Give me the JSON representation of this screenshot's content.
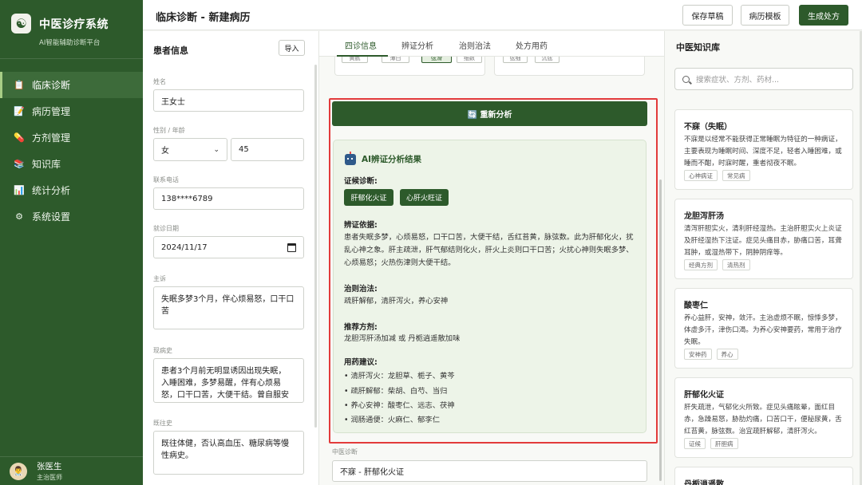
{
  "brand": {
    "title": "中医诊疗系统",
    "subtitle": "AI智能辅助诊断平台",
    "logo": "☯"
  },
  "nav": [
    {
      "label": "临床诊断",
      "icon": "clipboard-icon",
      "glyph": "📋",
      "active": true
    },
    {
      "label": "病历管理",
      "icon": "document-icon",
      "glyph": "📝",
      "active": false
    },
    {
      "label": "方剂管理",
      "icon": "pill-icon",
      "glyph": "💊",
      "active": false
    },
    {
      "label": "知识库",
      "icon": "books-icon",
      "glyph": "📚",
      "active": false
    },
    {
      "label": "统计分析",
      "icon": "chart-icon",
      "glyph": "📊",
      "active": false
    },
    {
      "label": "系统设置",
      "icon": "gear-icon",
      "glyph": "⚙",
      "active": false
    }
  ],
  "user": {
    "name": "张医生",
    "role": "主治医师",
    "avatar": "👨‍⚕️"
  },
  "header": {
    "title": "临床诊断 - 新建病历",
    "save_draft": "保存草稿",
    "template": "病历模板",
    "generate": "生成处方"
  },
  "patient": {
    "title": "患者信息",
    "import_label": "导入",
    "name_label": "姓名",
    "name": "王女士",
    "sex_age_label": "性别 / 年龄",
    "sex": "女",
    "age": "45",
    "phone_label": "联系电话",
    "phone": "138****6789",
    "date_label": "就诊日期",
    "date": "2024/11/17",
    "complaint_label": "主诉",
    "complaint": "失眠多梦3个月，伴心烦易怒，口干口苦",
    "history_label": "现病史",
    "history": "患者3个月前无明显诱因出现失眠，入睡困难，多梦易醒，伴有心烦易怒，口干口苦，大便干结。曾自服安神补脑液，效果不佳。",
    "past_label": "既往史",
    "past": "既往体健，否认高血压、糖尿病等慢性病史。"
  },
  "tabs": [
    {
      "label": "四诊信息",
      "active": true
    },
    {
      "label": "辨证分析",
      "active": false
    },
    {
      "label": "治则治法",
      "active": false
    },
    {
      "label": "处方用药",
      "active": false
    }
  ],
  "stub_chips": [
    "黄腻",
    "薄白",
    "弦滑",
    "细数",
    "弦细",
    "沉弦"
  ],
  "analysis": {
    "reanalyze": "🔄 重新分析",
    "result_title": "AI辨证分析结果",
    "dx_label": "证候诊断:",
    "dx_tags": [
      "肝郁化火证",
      "心肝火旺证"
    ],
    "basis_label": "辨证依据:",
    "basis": "患者失眠多梦，心烦易怒，口干口苦，大便干结，舌红苔黄，脉弦数。此为肝郁化火，扰乱心神之象。肝主疏泄，肝气郁结则化火，肝火上炎则口干口苦；火扰心神则失眠多梦、心烦易怒；火热伤津则大便干结。",
    "method_label": "治则治法:",
    "method": "疏肝解郁，清肝泻火，养心安神",
    "formula_label": "推荐方剂:",
    "formula": "龙胆泻肝汤加减 或 丹栀逍遥散加味",
    "herbs_label": "用药建议:",
    "herbs": [
      "• 清肝泻火：龙胆草、栀子、黄芩",
      "• 疏肝解郁：柴胡、白芍、当归",
      "• 养心安神：酸枣仁、远志、茯神",
      "• 润肠通便：火麻仁、郁李仁"
    ]
  },
  "tcm_dx": {
    "label": "中医诊断",
    "value": "不寐 - 肝郁化火证"
  },
  "kb": {
    "title": "中医知识库",
    "search_placeholder": "搜索症状、方剂、药材...",
    "cards": [
      {
        "name": "不寐（失眠）",
        "desc": "不寐是以经常不能获得正常睡眠为特征的一种病证，主要表现为睡眠时间、深度不足，轻者入睡困难，或睡而不酣，时寐时醒，重者彻夜不眠。",
        "tags": [
          "心神病证",
          "常见病"
        ]
      },
      {
        "name": "龙胆泻肝汤",
        "desc": "清泻肝胆实火，清利肝经湿热。主治肝胆实火上炎证及肝经湿热下注证。症见头痛目赤，胁痛口苦，耳聋耳肿，或湿热带下，阴肿阴痒等。",
        "tags": [
          "经典方剂",
          "清热剂"
        ]
      },
      {
        "name": "酸枣仁",
        "desc": "养心益肝，安神，敛汗。主治虚烦不眠，惊悸多梦，体虚多汗，津伤口渴。为养心安神要药，常用于治疗失眠。",
        "tags": [
          "安神药",
          "养心"
        ]
      },
      {
        "name": "肝郁化火证",
        "desc": "肝失疏泄，气郁化火所致。症见头痛眩晕，面红目赤，急躁易怒，胁肋灼痛，口苦口干，便秘尿黄，舌红苔黄，脉弦数。治宜疏肝解郁，清肝泻火。",
        "tags": [
          "证候",
          "肝胆病"
        ]
      },
      {
        "name": "丹栀逍遥散",
        "desc": "",
        "tags": []
      }
    ]
  }
}
